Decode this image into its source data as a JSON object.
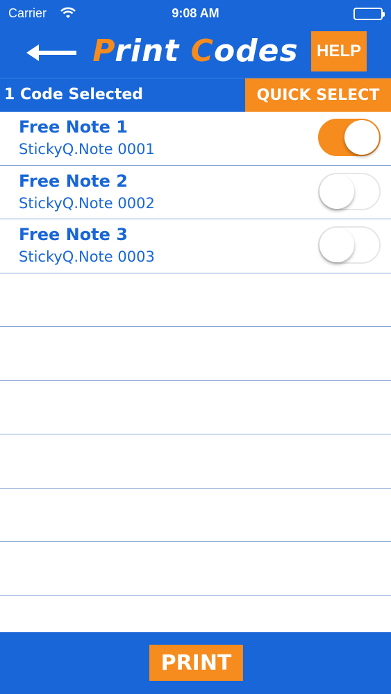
{
  "status_bar": {
    "carrier": "Carrier",
    "time": "9:08 AM"
  },
  "nav": {
    "title_p": "P",
    "title_rint": "rint ",
    "title_c": "C",
    "title_odes": "odes",
    "help_label": "HELP",
    "back_icon": "left-arrow-icon"
  },
  "sub_bar": {
    "selected_text": "1 Code Selected",
    "quick_select_label": "QUICK SELECT"
  },
  "items": [
    {
      "title": "Free Note 1",
      "subtitle": "StickyQ.Note 0001",
      "selected": true
    },
    {
      "title": "Free Note 2",
      "subtitle": "StickyQ.Note 0002",
      "selected": false
    },
    {
      "title": "Free Note 3",
      "subtitle": "StickyQ.Note 0003",
      "selected": false
    }
  ],
  "empty_rows": 7,
  "footer": {
    "print_label": "PRINT"
  },
  "colors": {
    "primary": "#1866d8",
    "accent": "#f68b1e",
    "row_divider": "#8aa6d6"
  }
}
